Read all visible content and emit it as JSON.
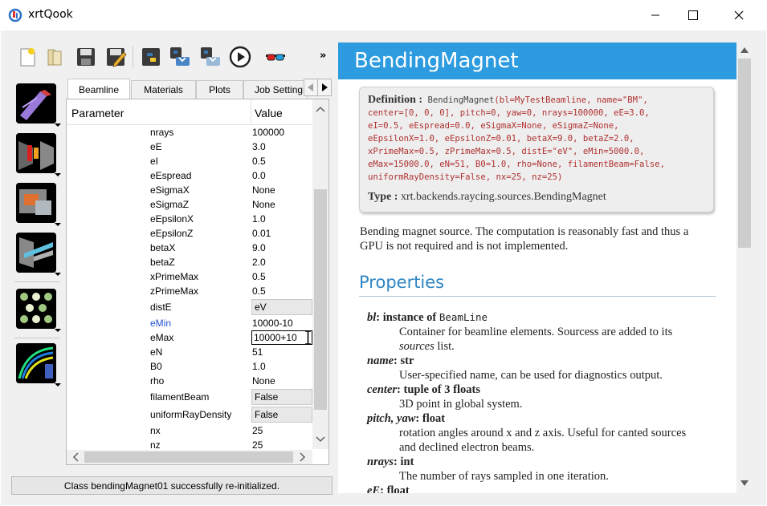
{
  "window": {
    "title": "xrtQook",
    "icons": {
      "app": "xrtqook-app-icon",
      "minimize": "minimize-icon",
      "maximize": "maximize-icon",
      "close": "close-icon"
    }
  },
  "toolbar": {
    "buttons": [
      "new-file-icon",
      "open-folder-icon",
      "save-icon",
      "save-as-icon",
      "python-icon",
      "save-script-icon",
      "save-run-icon",
      "run-icon",
      "glasses-3d-icon"
    ],
    "overflow_icon": "chevron-double-right-icon",
    "overflow_label": "»"
  },
  "palette": [
    "source-icon",
    "aperture-icon",
    "screen-icon",
    "optical-element-icon",
    "material-icon",
    "plot-icon"
  ],
  "tabs": [
    {
      "label": "Beamline",
      "active": true
    },
    {
      "label": "Materials",
      "active": false
    },
    {
      "label": "Plots",
      "active": false
    },
    {
      "label": "Job Setting",
      "active": false
    }
  ],
  "table": {
    "headers": {
      "parameter": "Parameter",
      "value": "Value"
    },
    "rows": [
      {
        "p": "nrays",
        "v": "100000"
      },
      {
        "p": "eE",
        "v": "3.0"
      },
      {
        "p": "eI",
        "v": "0.5"
      },
      {
        "p": "eEspread",
        "v": "0.0"
      },
      {
        "p": "eSigmaX",
        "v": "None"
      },
      {
        "p": "eSigmaZ",
        "v": "None"
      },
      {
        "p": "eEpsilonX",
        "v": "1.0"
      },
      {
        "p": "eEpsilonZ",
        "v": "0.01"
      },
      {
        "p": "betaX",
        "v": "9.0"
      },
      {
        "p": "betaZ",
        "v": "2.0"
      },
      {
        "p": "xPrimeMax",
        "v": "0.5"
      },
      {
        "p": "zPrimeMax",
        "v": "0.5"
      },
      {
        "p": "distE",
        "v": "eV"
      },
      {
        "p": "eMin",
        "v": "10000-10"
      },
      {
        "p": "eMax",
        "v": "10000+10"
      },
      {
        "p": "eN",
        "v": "51"
      },
      {
        "p": "B0",
        "v": "1.0"
      },
      {
        "p": "rho",
        "v": "None"
      },
      {
        "p": "filamentBeam",
        "v": "False"
      },
      {
        "p": "uniformRayDensity",
        "v": "False"
      },
      {
        "p": "nx",
        "v": "25"
      },
      {
        "p": "nz",
        "v": "25"
      }
    ],
    "highlight_color": "#1e50d0"
  },
  "status": "Class bendingMagnet01 successfully re-initialized.",
  "doc": {
    "title": "BendingMagnet",
    "header_color": "#2d9bdf",
    "definition_label": "Definition :",
    "definition_name": "BendingMagnet",
    "definition_lines": [
      "(bl=MyTestBeamline, name=\"BM\",",
      "center=[0, 0, 0], pitch=0, yaw=0, nrays=100000, eE=3.0,",
      "eI=0.5, eEspread=0.0, eSigmaX=None, eSigmaZ=None,",
      "eEpsilonX=1.0, eEpsilonZ=0.01, betaX=9.0, betaZ=2.0,",
      "xPrimeMax=0.5, zPrimeMax=0.5, distE=\"eV\", eMin=5000.0,",
      "eMax=15000.0, eN=51, B0=1.0, rho=None, filamentBeam=False,",
      "uniformRayDensity=False, nx=25, nz=25)"
    ],
    "type_label": "Type :",
    "type_value": "xrt.backends.raycing.sources.BendingMagnet",
    "description": "Bending magnet source. The computation is reasonably fast and thus a GPU is not required and is not implemented.",
    "properties_heading": "Properties",
    "properties": [
      {
        "name": "bl",
        "sep": ":",
        "type_prefix": "instance of",
        "type_mono": "BeamLine",
        "desc": "Container for beamline elements. Sourcess are added to its",
        "desc_em": "sources",
        "desc_tail": "list."
      },
      {
        "name": "name",
        "sep": ":",
        "type": "str",
        "desc": "User-specified name, can be used for diagnostics output."
      },
      {
        "name": "center",
        "sep": ":",
        "type": "tuple of 3 floats",
        "desc": "3D point in global system."
      },
      {
        "name": "pitch, yaw",
        "sep": ":",
        "type": "float",
        "desc": "rotation angles around x and z axis. Useful for canted sources and declined electron beams."
      },
      {
        "name": "nrays",
        "sep": ":",
        "type": "int",
        "desc": "The number of rays sampled in one iteration."
      },
      {
        "name": "eE",
        "sep": ":",
        "type": "float",
        "desc": ""
      }
    ]
  }
}
